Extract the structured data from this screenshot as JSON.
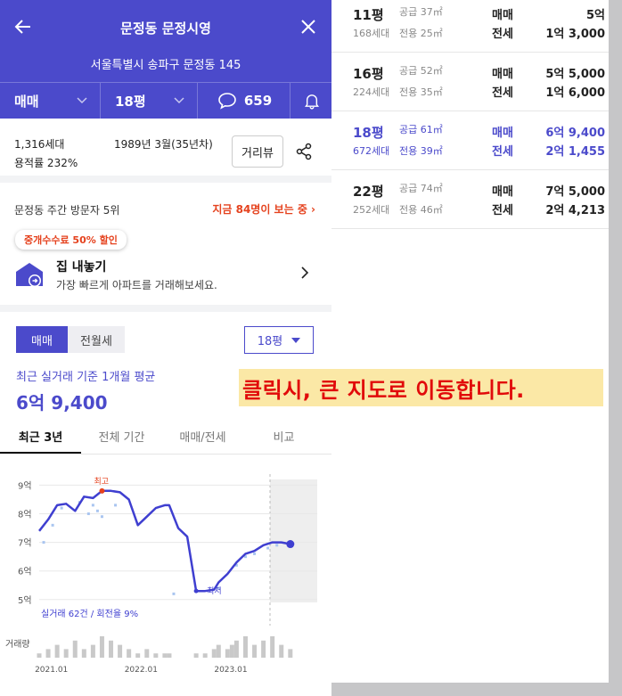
{
  "header": {
    "title": "문정동 문정시영",
    "address": "서울특별시 송파구 문정동 145",
    "trade_type": "매매",
    "size": "18평",
    "comments": "659"
  },
  "info": {
    "households": "1,316세대",
    "built": "1989년 3월(35년차)",
    "far": "용적률 232%",
    "streetview": "거리뷰"
  },
  "visitor": {
    "rank": "문정동 주간 방문자 5위",
    "now_viewing": "지금 84명이 보는 중"
  },
  "promo": {
    "badge": "중개수수료 50% 할인",
    "title": "집 내놓기",
    "subtitle": "가장 빠르게 아파트를 거래해보세요."
  },
  "price": {
    "seg_on": "매매",
    "seg_off": "전월세",
    "size_select": "18평",
    "avg_label": "최근 실거래 기준 1개월 평균",
    "avg_value": "6억 9,400"
  },
  "period_tabs": [
    "최근 3년",
    "전체 기간",
    "매매/전세",
    "비교"
  ],
  "notice": "클릭시, 큰 지도로 이동합니다.",
  "chart_data": {
    "type": "line",
    "title": "",
    "xlabel": "",
    "ylabel": "",
    "y_unit": "억",
    "yticks": [
      9,
      8,
      7,
      6,
      5
    ],
    "ylim": [
      4.9,
      9.2
    ],
    "x_ticks": [
      "2021.01",
      "2022.01",
      "2023.01"
    ],
    "xlim": [
      2020.9,
      2024.0
    ],
    "high_label": "최고",
    "low_label": "최저",
    "trade_summary": "실거래 62건 / 회전율 9%",
    "volume_label": "거래량",
    "series": [
      {
        "name": "",
        "x": [
          2020.9,
          2021.0,
          2021.1,
          2021.2,
          2021.3,
          2021.4,
          2021.5,
          2021.6,
          2021.7,
          2021.8,
          2021.9,
          2022.0,
          2022.1,
          2022.2,
          2022.3,
          2022.35,
          2022.45,
          2022.55,
          2022.65,
          2022.75,
          2022.85,
          2022.9,
          2023.0,
          2023.05,
          2023.1,
          2023.2,
          2023.3,
          2023.4,
          2023.5,
          2023.6,
          2023.7
        ],
        "y": [
          7.4,
          7.8,
          8.3,
          8.35,
          8.1,
          8.6,
          8.55,
          8.8,
          8.8,
          8.75,
          8.5,
          7.6,
          7.9,
          8.2,
          8.3,
          8.3,
          7.5,
          7.2,
          5.3,
          5.3,
          5.35,
          5.6,
          5.9,
          6.1,
          6.3,
          6.6,
          6.7,
          6.9,
          7.0,
          7.0,
          6.94
        ]
      }
    ],
    "scatter_points": [
      [
        2020.95,
        7.0
      ],
      [
        2021.05,
        7.6
      ],
      [
        2021.15,
        8.2
      ],
      [
        2021.35,
        8.4
      ],
      [
        2021.45,
        8.0
      ],
      [
        2021.5,
        8.3
      ],
      [
        2021.55,
        8.1
      ],
      [
        2021.6,
        7.9
      ],
      [
        2021.75,
        8.3
      ],
      [
        2022.4,
        5.2
      ],
      [
        2022.9,
        5.4
      ],
      [
        2023.1,
        6.2
      ],
      [
        2023.2,
        6.5
      ],
      [
        2023.3,
        6.6
      ],
      [
        2023.45,
        6.8
      ],
      [
        2023.55,
        6.9
      ]
    ],
    "volume": [
      1,
      2,
      3,
      2,
      4,
      2,
      3,
      5,
      4,
      3,
      2,
      1,
      2,
      1,
      1,
      1,
      0,
      0,
      1,
      1,
      2,
      3,
      2,
      3,
      4,
      5,
      3,
      4,
      5,
      3,
      2
    ]
  },
  "pyeong_rows": [
    {
      "py": "11평",
      "households": "168세대",
      "supply": "공급 37㎡",
      "exclusive": "전용 25㎡",
      "t1": "매매",
      "v1": "5억",
      "t2": "전세",
      "v2": "1억 3,000",
      "selected": false
    },
    {
      "py": "16평",
      "households": "224세대",
      "supply": "공급 52㎡",
      "exclusive": "전용 35㎡",
      "t1": "매매",
      "v1": "5억 5,000",
      "t2": "전세",
      "v2": "1억 6,000",
      "selected": false
    },
    {
      "py": "18평",
      "households": "672세대",
      "supply": "공급 61㎡",
      "exclusive": "전용 39㎡",
      "t1": "매매",
      "v1": "6억 9,400",
      "t2": "전세",
      "v2": "2억 1,455",
      "selected": true
    },
    {
      "py": "22평",
      "households": "252세대",
      "supply": "공급 74㎡",
      "exclusive": "전용 46㎡",
      "t1": "매매",
      "v1": "7억 5,000",
      "t2": "전세",
      "v2": "2억 4,213",
      "selected": false
    }
  ],
  "colors": {
    "brand": "#4b4acb",
    "alert": "#e5421e",
    "notice_bg": "#fbe8a6",
    "notice_text": "#e10a0a"
  }
}
